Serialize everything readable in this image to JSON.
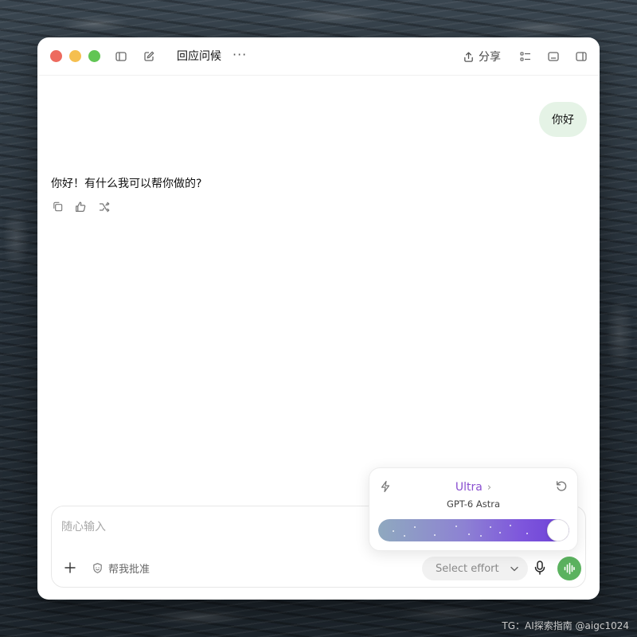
{
  "window": {
    "title": "回应问候",
    "more_label": "···",
    "share_label": "分享"
  },
  "icons": {
    "sidebar": "sidebar-toggle-icon",
    "new_chat": "compose-icon",
    "share": "upload-icon",
    "tasks": "checklist-icon",
    "terminal": "bottom-panel-icon",
    "right_panel": "right-panel-icon",
    "copy": "copy-icon",
    "feedback": "thumbs-icon",
    "branch": "branch-icon",
    "bolt": "bolt-icon",
    "reset": "reset-icon",
    "plus": "plus-icon",
    "approve": "shield-icon",
    "mic": "microphone-icon",
    "voice": "voice-wave-icon"
  },
  "conversation": {
    "user_message": "你好",
    "assistant_message": "你好！有什么我可以帮你做的?"
  },
  "composer": {
    "placeholder": "随心输入",
    "approve_label": "帮我批准",
    "effort_select_label": "Select effort"
  },
  "effort_popover": {
    "level": "Ultra",
    "level_arrow": "›",
    "model": "GPT-6 Astra",
    "level_fraction": 1.0
  },
  "colors": {
    "user_bubble": "#e5f3e6",
    "level_text": "#8a4fd0",
    "voice_button": "#5bb25f",
    "traffic_red": "#ed6a5e",
    "traffic_yellow": "#f5bf4f",
    "traffic_green": "#61c554"
  },
  "watermark": "TG：AI探索指南 @aigc1024"
}
